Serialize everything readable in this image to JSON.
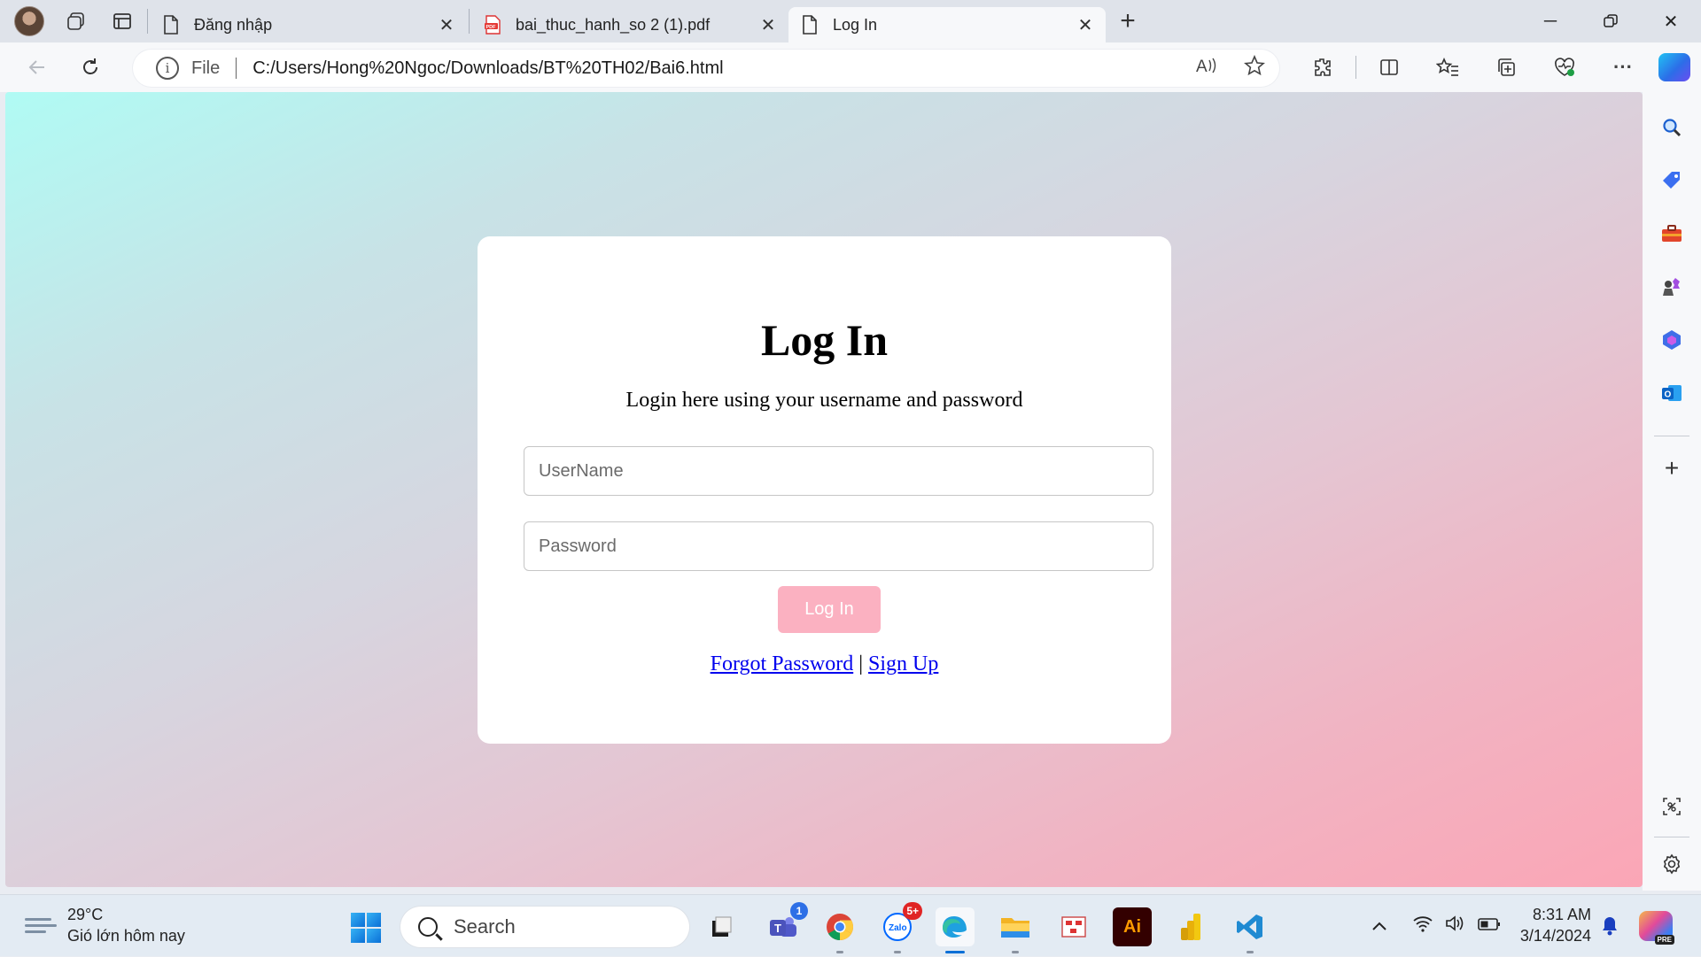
{
  "browser": {
    "tabs": [
      {
        "label": "Đăng nhập",
        "active": false,
        "icon": "page-icon"
      },
      {
        "label": "bai_thuc_hanh_so 2 (1).pdf",
        "active": false,
        "icon": "pdf-icon"
      },
      {
        "label": "Log In",
        "active": true,
        "icon": "page-icon"
      }
    ],
    "address": {
      "scheme_label": "File",
      "url": "C:/Users/Hong%20Ngoc/Downloads/BT%20TH02/Bai6.html"
    }
  },
  "page": {
    "title": "Log In",
    "subtitle": "Login here using your username and password",
    "username_placeholder": "UserName",
    "password_placeholder": "Password",
    "login_button": "Log In",
    "forgot_link": "Forgot Password",
    "separator": "|",
    "signup_link": "Sign Up",
    "colors": {
      "gradient_start": "#b0fbf4",
      "gradient_end": "#fba6b6",
      "button_bg": "#fbb1c1",
      "link": "#0000ee"
    }
  },
  "taskbar": {
    "weather_temp": "29°C",
    "weather_desc": "Gió lớn hôm nay",
    "search_label": "Search",
    "apps": [
      {
        "name": "teams",
        "badge": "1"
      },
      {
        "name": "chrome",
        "badge": ""
      },
      {
        "name": "zalo",
        "badge": "5+",
        "label": "Zalo"
      },
      {
        "name": "edge",
        "badge": ""
      },
      {
        "name": "file-explorer",
        "badge": ""
      },
      {
        "name": "illustrator",
        "label": "Ai"
      },
      {
        "name": "power-bi",
        "badge": ""
      },
      {
        "name": "vscode",
        "badge": ""
      }
    ],
    "time": "8:31 AM",
    "date": "3/14/2024"
  }
}
